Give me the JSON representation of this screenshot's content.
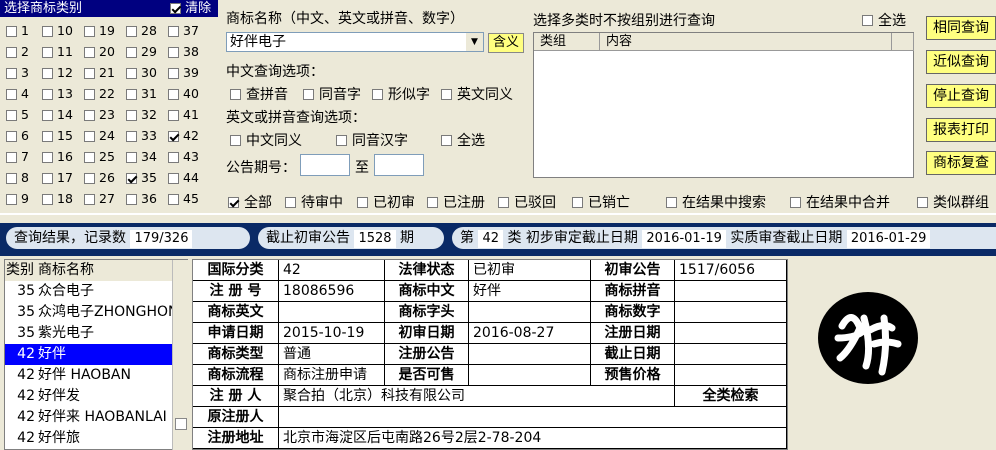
{
  "class_panel": {
    "header": "选择商标类别",
    "clear_label": "清除",
    "clear_checked": true,
    "columns": [
      [
        "1",
        "2",
        "3",
        "4",
        "5",
        "6",
        "7",
        "8",
        "9"
      ],
      [
        "10",
        "11",
        "12",
        "13",
        "14",
        "15",
        "16",
        "17",
        "18"
      ],
      [
        "19",
        "20",
        "21",
        "22",
        "23",
        "24",
        "25",
        "26",
        "27"
      ],
      [
        "28",
        "29",
        "30",
        "31",
        "32",
        "33",
        "34",
        "35",
        "36"
      ],
      [
        "37",
        "38",
        "39",
        "40",
        "41",
        "42",
        "43",
        "44",
        "45"
      ]
    ],
    "checked": [
      "35",
      "42"
    ]
  },
  "search": {
    "name_label": "商标名称（中文、英文或拼音、数字）",
    "name_value": "好伴电子",
    "meaning_button": "含义",
    "cn_options_label": "中文查询选项：",
    "cn_options": [
      "查拼音",
      "同音字",
      "形似字",
      "英文同义"
    ],
    "en_options_label": "英文或拼音查询选项：",
    "en_options": [
      "中文同义",
      "同音汉字",
      "全选"
    ],
    "gazette_label": "公告期号：",
    "to_label": "至"
  },
  "multi": {
    "label": "选择多类时不按组别进行查询",
    "all_label": "全选",
    "col_group": "类组",
    "col_content": "内容"
  },
  "buttons": [
    "相同查询",
    "近似查询",
    "停止查询",
    "报表打印",
    "商标复查"
  ],
  "status_filters": [
    {
      "label": "全部",
      "checked": true
    },
    {
      "label": "待审中",
      "checked": false
    },
    {
      "label": "已初审",
      "checked": false
    },
    {
      "label": "已注册",
      "checked": false
    },
    {
      "label": "已驳回",
      "checked": false
    },
    {
      "label": "已销亡",
      "checked": false
    }
  ],
  "result_options": [
    "在结果中搜索",
    "在结果中合并",
    "类似群组"
  ],
  "info_bar": {
    "result_label": "查询结果，记录数",
    "result_value": "179/326",
    "deadline_label": "截止初审公告",
    "deadline_value": "1528",
    "deadline_unit": "期",
    "class_prefix": "第",
    "class_value": "42",
    "class_suffix": "类",
    "prelim_label": "初步审定截止日期",
    "prelim_value": "2016-01-19",
    "real_label": "实质审查截止日期",
    "real_value": "2016-01-29"
  },
  "list": {
    "col_class": "类别",
    "col_name": "商标名称",
    "rows": [
      {
        "cls": "35",
        "name": "众合电子"
      },
      {
        "cls": "35",
        "name": "众鸿电子ZHONGHON"
      },
      {
        "cls": "35",
        "name": "紫光电子"
      },
      {
        "cls": "42",
        "name": "好伴",
        "selected": true
      },
      {
        "cls": "42",
        "name": "好伴 HAOBAN"
      },
      {
        "cls": "42",
        "name": "好伴发"
      },
      {
        "cls": "42",
        "name": "好伴来 HAOBANLAI"
      },
      {
        "cls": "42",
        "name": "好伴旅"
      }
    ]
  },
  "detail": {
    "intl_class_k": "国际分类",
    "intl_class_v": "42",
    "legal_k": "法律状态",
    "legal_v": "已初审",
    "prelim_pub_k": "初审公告",
    "prelim_pub_v": "1517/6056",
    "reg_no_k": "注 册 号",
    "reg_no_v": "18086596",
    "cn_k": "商标中文",
    "cn_v": "好伴",
    "pinyin_k": "商标拼音",
    "pinyin_v": "",
    "en_k": "商标英文",
    "en_v": "",
    "head_k": "商标字头",
    "head_v": "",
    "num_k": "商标数字",
    "num_v": "",
    "apply_date_k": "申请日期",
    "apply_date_v": "2015-10-19",
    "prelim_date_k": "初审日期",
    "prelim_date_v": "2016-08-27",
    "reg_date_k": "注册日期",
    "reg_date_v": "",
    "type_k": "商标类型",
    "type_v": "普通",
    "reg_pub_k": "注册公告",
    "reg_pub_v": "",
    "end_date_k": "截止日期",
    "end_date_v": "",
    "flow_k": "商标流程",
    "flow_v": "商标注册申请\n",
    "sale_k": "是否可售",
    "sale_v": "",
    "presale_k": "预售价格",
    "presale_v": "",
    "registrant_k": "注 册 人",
    "registrant_v": "聚合拍（北京）科技有限公司",
    "all_search": "全类检索",
    "orig_k": "原注册人",
    "orig_v": "",
    "addr_k": "注册地址",
    "addr_v": "北京市海淀区后屯南路26号2层2-78-204"
  }
}
